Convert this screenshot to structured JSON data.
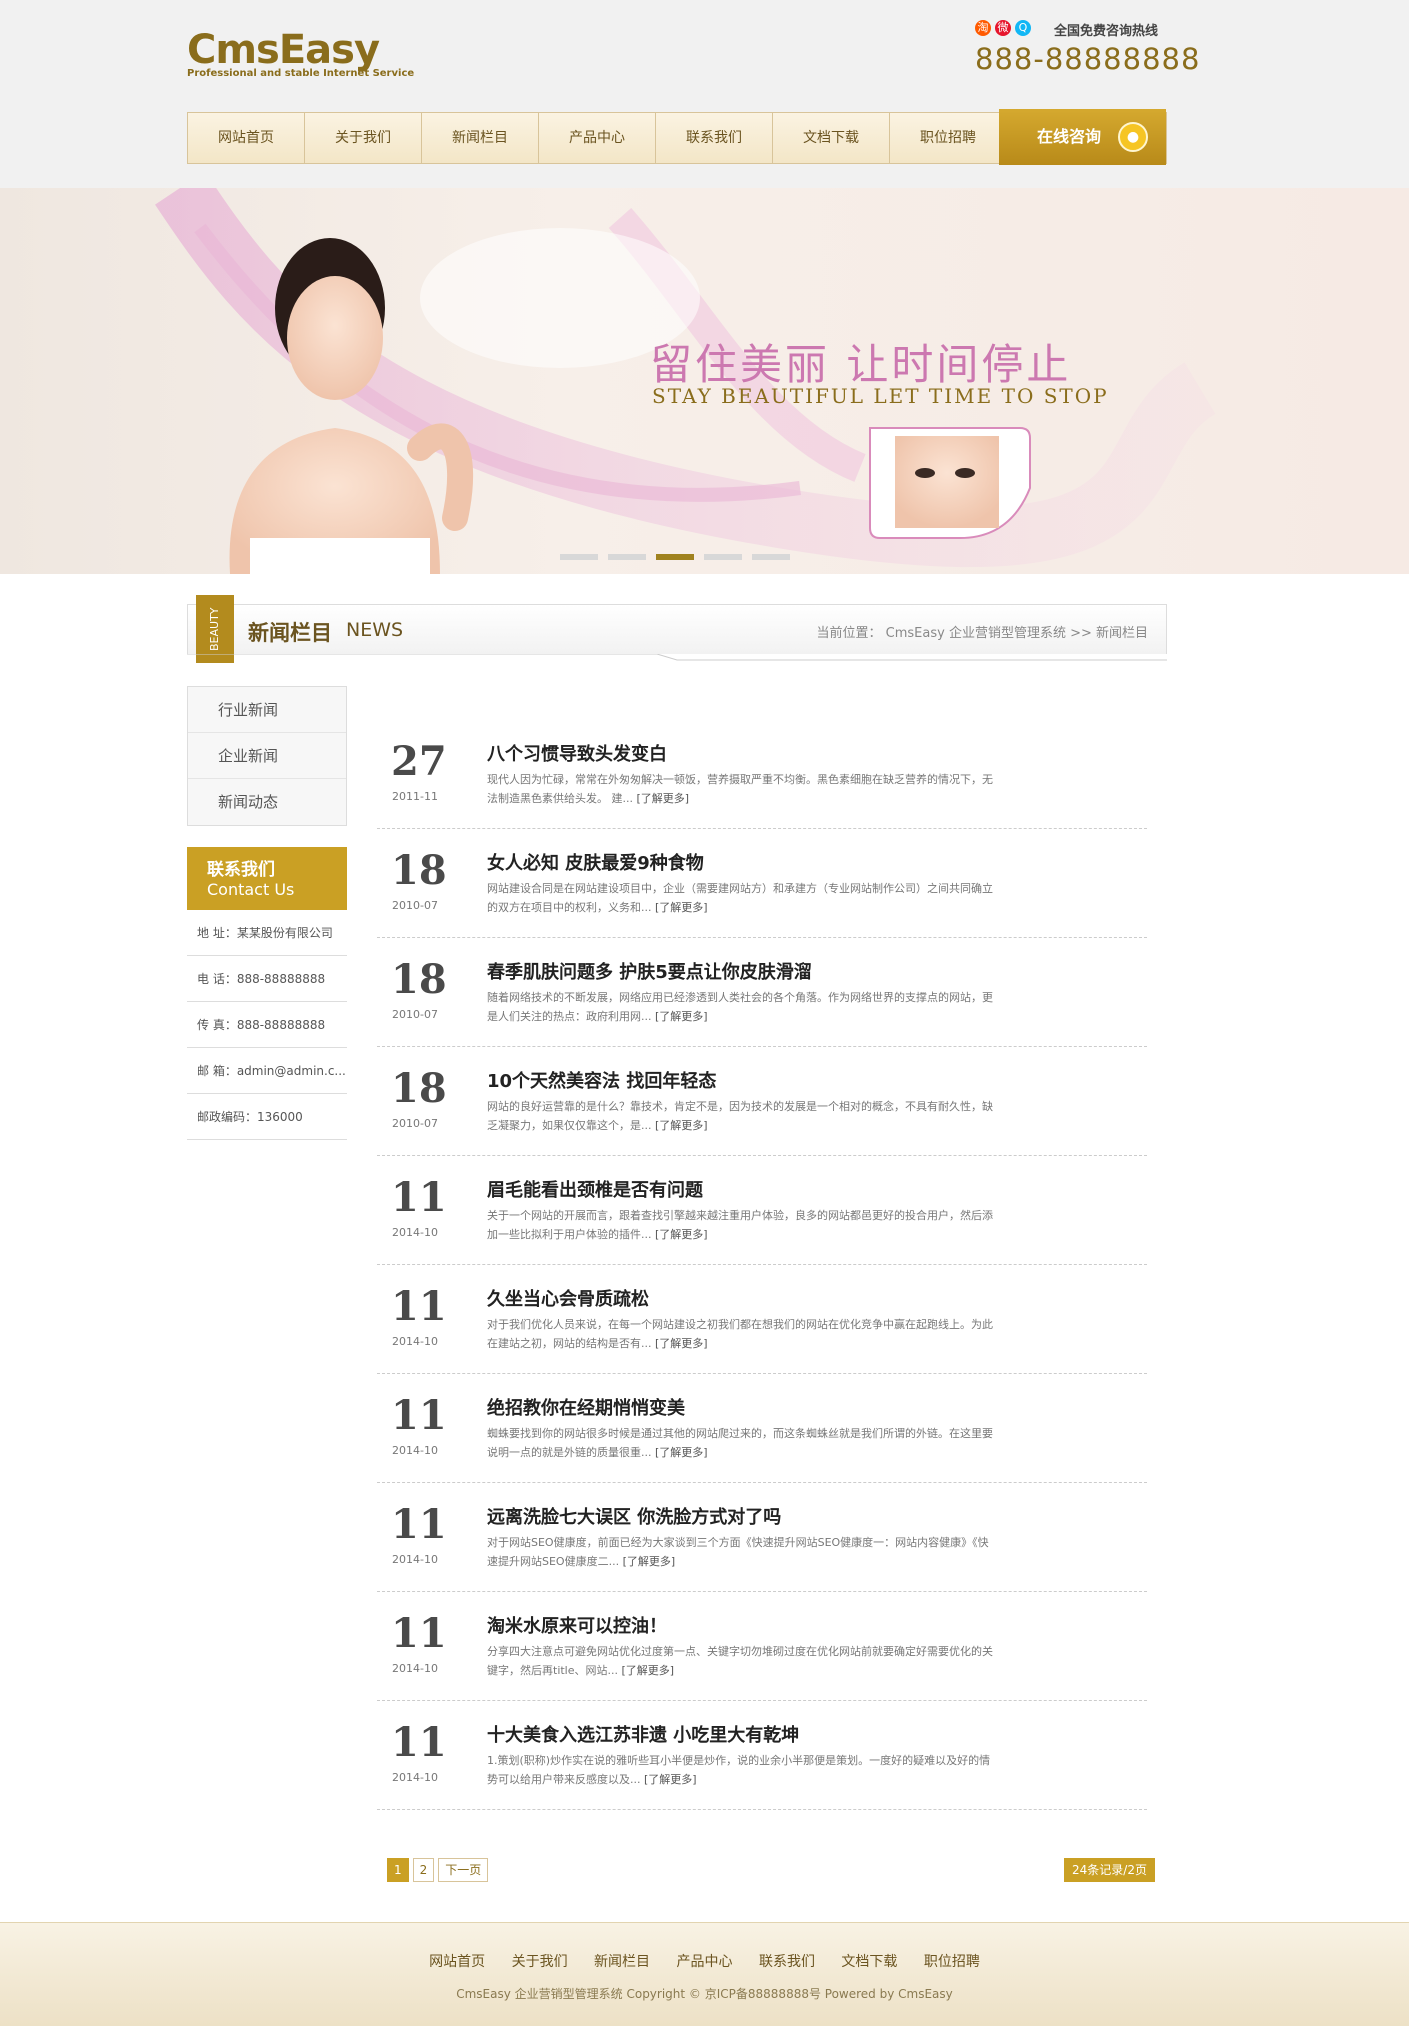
{
  "logo": {
    "main": "CmsEasy",
    "sub": "Professional and stable Internet Service"
  },
  "hotline": {
    "icons": [
      "淘",
      "微",
      "Q"
    ],
    "label": "全国免费咨询热线",
    "number": "888-88888888"
  },
  "nav": {
    "items": [
      "网站首页",
      "关于我们",
      "新闻栏目",
      "产品中心",
      "联系我们",
      "文档下载",
      "职位招聘"
    ],
    "consult": "在线咨询"
  },
  "banner": {
    "title_cn": "留住美丽 让时间停止",
    "title_en": "STAY BEAUTIFUL LET TIME TO STOP",
    "dots": 5,
    "active_dot": 3
  },
  "section": {
    "badge": "BEAUTY",
    "title": "新闻栏目",
    "title_en": "NEWS",
    "breadcrumb": "当前位置： CmsEasy 企业营销型管理系统  >>  新闻栏目"
  },
  "sidebar": {
    "items": [
      "行业新闻",
      "企业新闻",
      "新闻动态"
    ],
    "contact_title": "联系我们",
    "contact_en": "Contact Us",
    "contact_rows": [
      "地 址：某某股份有限公司",
      "电 话：888-88888888",
      "传 真：888-88888888",
      "邮 箱：admin@admin.c...",
      "邮政编码：136000"
    ]
  },
  "news": [
    {
      "day": "27",
      "ym": "2011-11",
      "title": "八个习惯导致头发变白",
      "summary": "现代人因为忙碌，常常在外匆匆解决一顿饭，营养摄取严重不均衡。黑色素细胞在缺乏营养的情况下，无法制造黑色素供给头发。 建...",
      "more": "[了解更多]"
    },
    {
      "day": "18",
      "ym": "2010-07",
      "title": "女人必知 皮肤最爱9种食物",
      "summary": "网站建设合同是在网站建设项目中，企业（需要建网站方）和承建方（专业网站制作公司）之间共同确立的双方在项目中的权利，义务和...",
      "more": "[了解更多]"
    },
    {
      "day": "18",
      "ym": "2010-07",
      "title": "春季肌肤问题多 护肤5要点让你皮肤滑溜",
      "summary": "随着网络技术的不断发展，网络应用已经渗透到人类社会的各个角落。作为网络世界的支撑点的网站，更是人们关注的热点：政府利用网...",
      "more": "[了解更多]"
    },
    {
      "day": "18",
      "ym": "2010-07",
      "title": "10个天然美容法 找回年轻态",
      "summary": "网站的良好运营靠的是什么？靠技术，肯定不是，因为技术的发展是一个相对的概念，不具有耐久性，缺乏凝聚力，如果仅仅靠这个，是...",
      "more": "[了解更多]"
    },
    {
      "day": "11",
      "ym": "2014-10",
      "title": "眉毛能看出颈椎是否有问题",
      "summary": "关于一个网站的开展而言，跟着查找引擎越来越注重用户体验，良多的网站都邑更好的投合用户，然后添加一些比拟利于用户体验的插件...",
      "more": "[了解更多]"
    },
    {
      "day": "11",
      "ym": "2014-10",
      "title": "久坐当心会骨质疏松",
      "summary": "对于我们优化人员来说，在每一个网站建设之初我们都在想我们的网站在优化竞争中赢在起跑线上。为此在建站之初，网站的结构是否有...",
      "more": "[了解更多]"
    },
    {
      "day": "11",
      "ym": "2014-10",
      "title": "绝招教你在经期悄悄变美",
      "summary": "蜘蛛要找到你的网站很多时候是通过其他的网站爬过来的，而这条蜘蛛丝就是我们所谓的外链。在这里要说明一点的就是外链的质量很重...",
      "more": "[了解更多]"
    },
    {
      "day": "11",
      "ym": "2014-10",
      "title": "远离洗脸七大误区 你洗脸方式对了吗",
      "summary": "对于网站SEO健康度，前面已经为大家谈到三个方面《快速提升网站SEO健康度一：网站内容健康》《快速提升网站SEO健康度二...",
      "more": "[了解更多]"
    },
    {
      "day": "11",
      "ym": "2014-10",
      "title": "淘米水原来可以控油！",
      "summary": "分享四大注意点可避免网站优化过度第一点、关键字切勿堆砌过度在优化网站前就要确定好需要优化的关键字，然后再title、网站...",
      "more": "[了解更多]"
    },
    {
      "day": "11",
      "ym": "2014-10",
      "title": "十大美食入选江苏非遗 小吃里大有乾坤",
      "summary": "1.策划(职称)炒作实在说的雅听些耳小半便是炒作，说的业余小半那便是策划。一度好的疑难以及好的情势可以给用户带来反感度以及...",
      "more": "[了解更多]"
    }
  ],
  "pager": {
    "pages": [
      "1",
      "2"
    ],
    "next": "下一页",
    "total": "24条记录/2页"
  },
  "footer": {
    "nav": [
      "网站首页",
      "关于我们",
      "新闻栏目",
      "产品中心",
      "联系我们",
      "文档下载",
      "职位招聘"
    ],
    "copyright": "CmsEasy 企业营销型管理系统 Copyright © 京ICP备88888888号 Powered by CmsEasy"
  },
  "colors": {
    "gold": "#caa024",
    "brown": "#8a6d1c",
    "pink": "#cc78b0"
  }
}
